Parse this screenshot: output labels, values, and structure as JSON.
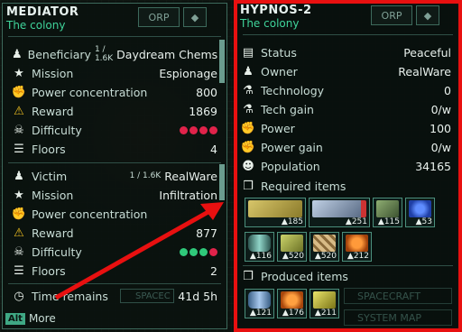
{
  "left": {
    "title": "MEDIATOR",
    "subtitle": "The colony",
    "hdr_btn_orp": "ORP",
    "beneficiary": {
      "label": "Beneficiary",
      "small": "1 / 1.6K",
      "value": "Daydream Chems"
    },
    "mission1": {
      "label": "Mission",
      "value": "Espionage"
    },
    "power1": {
      "label": "Power concentration",
      "value": "800"
    },
    "reward1": {
      "label": "Reward",
      "value": "1869"
    },
    "difficulty1": {
      "label": "Difficulty",
      "dots": [
        "#e0234a",
        "#e0234a",
        "#e0234a",
        "#e0234a"
      ]
    },
    "floors1": {
      "label": "Floors",
      "value": "4"
    },
    "victim": {
      "label": "Victim",
      "small": "1 / 1.6K",
      "value": "RealWare"
    },
    "mission2": {
      "label": "Mission",
      "value": "Infiltration"
    },
    "power2": {
      "label": "Power concentration",
      "value": ""
    },
    "reward2": {
      "label": "Reward",
      "value": "877"
    },
    "difficulty2": {
      "label": "Difficulty",
      "dots": [
        "#2fc97a",
        "#2fc97a",
        "#2fc97a",
        "#e0234a"
      ]
    },
    "floors2": {
      "label": "Floors",
      "value": "2"
    },
    "time": {
      "label": "Time remains",
      "value": "41d 5h"
    },
    "bg_spacecraft": "SPACEC",
    "alt_key": "Alt",
    "more": "More"
  },
  "right": {
    "title": "HYPNOS-2",
    "subtitle": "The colony",
    "hdr_btn_orp": "ORP",
    "status": {
      "label": "Status",
      "value": "Peaceful"
    },
    "owner": {
      "label": "Owner",
      "value": "RealWare"
    },
    "technology": {
      "label": "Technology",
      "value": "0"
    },
    "tech_gain": {
      "label": "Tech gain",
      "value": "0/w"
    },
    "power": {
      "label": "Power",
      "value": "100"
    },
    "power_gain": {
      "label": "Power gain",
      "value": "0/w"
    },
    "population": {
      "label": "Population",
      "value": "34165"
    },
    "required_label": "Required items",
    "required": [
      {
        "count": "185",
        "color": "#b4a24a",
        "name": "gold-bars-icon",
        "wide": true
      },
      {
        "count": "251",
        "color": "#8aa8c8",
        "name": "machinery-icon",
        "wide": true
      },
      {
        "count": "115",
        "color": "#6f8a58",
        "name": "circuit-crate-icon"
      },
      {
        "count": "53",
        "color": "#3d6fe0",
        "name": "blue-orbs-icon"
      },
      {
        "count": "116",
        "color": "#6bb0a8",
        "name": "canister-icon"
      },
      {
        "count": "520",
        "color": "#a7b04a",
        "name": "yellow-crate-icon"
      },
      {
        "count": "520",
        "color": "#b89a64",
        "name": "brick-stack-icon"
      },
      {
        "count": "212",
        "color": "#e06a1a",
        "name": "orange-cells-icon"
      }
    ],
    "produced_label": "Produced items",
    "produced": [
      {
        "count": "121",
        "color": "#6b9acb",
        "name": "blue-canister-icon"
      },
      {
        "count": "176",
        "color": "#e07020",
        "name": "orange-cells-icon"
      },
      {
        "count": "211",
        "color": "#c9c23a",
        "name": "chip-icon"
      }
    ],
    "bg_spacecraft": "SPACECRAFT",
    "bg_system_map": "SYSTEM MAP"
  }
}
